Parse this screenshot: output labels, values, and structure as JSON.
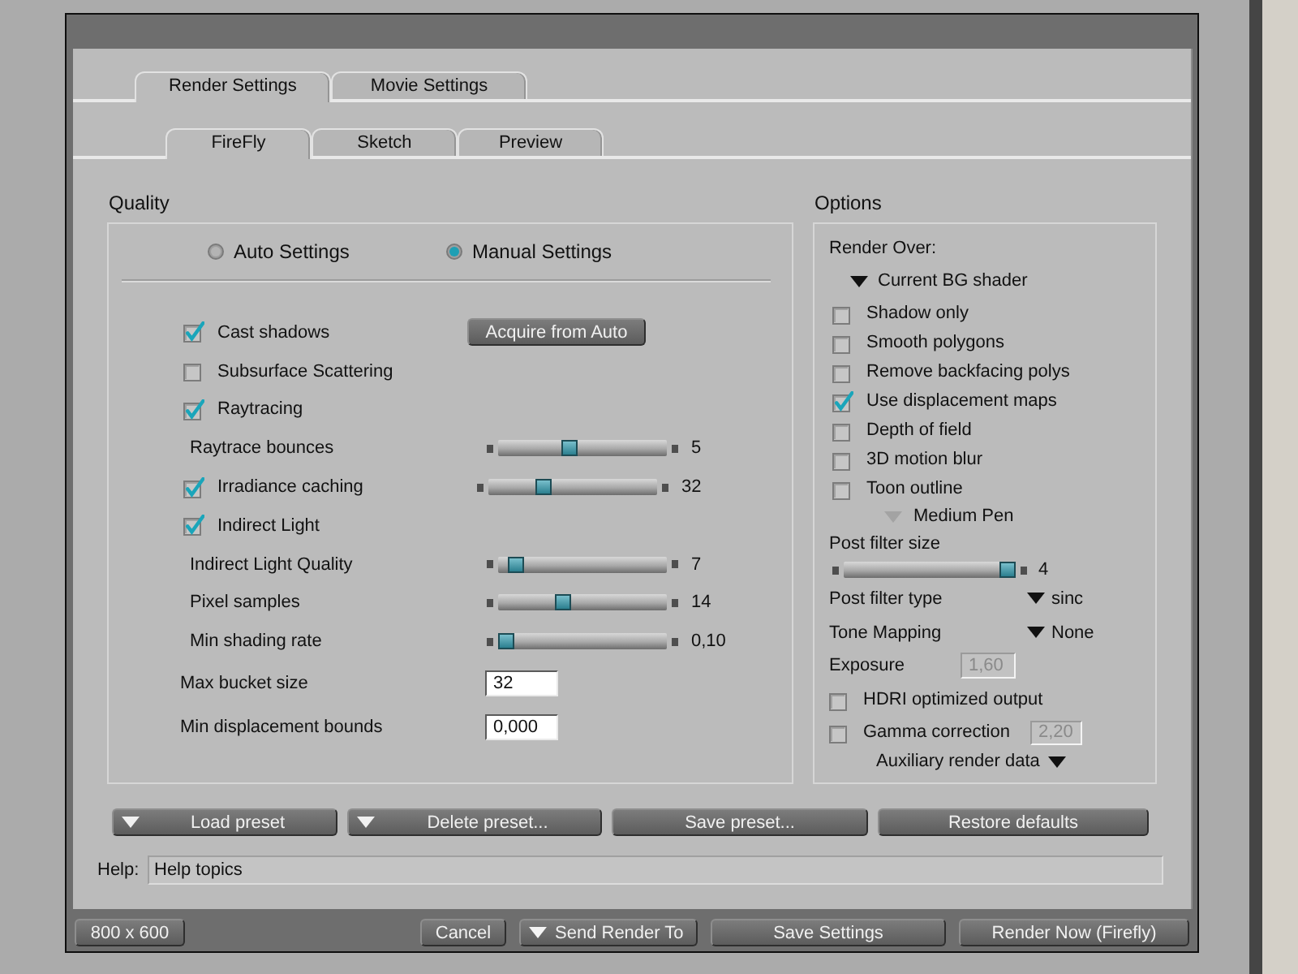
{
  "tabs": [
    {
      "label": "Render Settings",
      "selected": true
    },
    {
      "label": "Movie Settings",
      "selected": false
    }
  ],
  "subtabs": [
    {
      "label": "FireFly",
      "selected": true
    },
    {
      "label": "Sketch",
      "selected": false
    },
    {
      "label": "Preview",
      "selected": false
    }
  ],
  "quality": {
    "title": "Quality",
    "modes": [
      {
        "label": "Auto Settings",
        "selected": false
      },
      {
        "label": "Manual Settings",
        "selected": true
      }
    ],
    "acquire_button": "Acquire from Auto",
    "rows": [
      {
        "kind": "checkbox",
        "label": "Cast shadows",
        "checked": true
      },
      {
        "kind": "checkbox",
        "label": "Subsurface Scattering",
        "checked": false
      },
      {
        "kind": "checkbox",
        "label": "Raytracing",
        "checked": true
      },
      {
        "kind": "slider",
        "label": "Raytrace bounces",
        "level": 0.42,
        "reading": "5"
      },
      {
        "kind": "checkbox_slider",
        "label": "Irradiance caching",
        "checked": true,
        "level": 0.31,
        "reading": "32"
      },
      {
        "kind": "checkbox",
        "label": "Indirect Light",
        "checked": true
      },
      {
        "kind": "slider",
        "label": "Indirect Light Quality",
        "level": 0.06,
        "reading": "7"
      },
      {
        "kind": "slider",
        "label": "Pixel samples",
        "level": 0.37,
        "reading": "14"
      },
      {
        "kind": "slider",
        "label": "Min shading rate",
        "level": 0.0,
        "reading": "0,10"
      },
      {
        "kind": "input",
        "label": "Max bucket size",
        "value": "32"
      },
      {
        "kind": "input",
        "label": "Min displacement bounds",
        "value": "0,000"
      }
    ]
  },
  "options": {
    "title": "Options",
    "render_over": {
      "label": "Render Over:",
      "value": "Current BG shader"
    },
    "checkboxes": [
      {
        "label": "Shadow only",
        "checked": false
      },
      {
        "label": "Smooth polygons",
        "checked": false
      },
      {
        "label": "Remove backfacing polys",
        "checked": false
      },
      {
        "label": "Use displacement maps",
        "checked": true
      },
      {
        "label": "Depth of field",
        "checked": false
      },
      {
        "label": "3D motion blur",
        "checked": false
      },
      {
        "label": "Toon outline",
        "checked": false
      }
    ],
    "toon_pen": {
      "value": "Medium Pen",
      "disabled": true
    },
    "rows": [
      {
        "kind": "slider",
        "label": "Post filter size",
        "level": 1.0,
        "reading": "4"
      },
      {
        "kind": "dropdown",
        "label": "Post filter type",
        "value": "sinc"
      },
      {
        "kind": "dropdown",
        "label": "Tone Mapping",
        "value": "None"
      },
      {
        "kind": "input",
        "label": "Exposure",
        "value": "1,60",
        "disabled": true
      },
      {
        "kind": "checkbox",
        "label": "HDRI optimized output",
        "checked": false
      },
      {
        "kind": "checkbox_input",
        "label": "Gamma correction",
        "checked": false,
        "value": "2,20",
        "disabled": true
      },
      {
        "kind": "menu",
        "label": "Auxiliary render data"
      }
    ]
  },
  "preset_buttons": [
    {
      "label": "Load preset",
      "kind": "menu"
    },
    {
      "label": "Delete preset...",
      "kind": "menu"
    },
    {
      "label": "Save preset...",
      "kind": "plain"
    },
    {
      "label": "Restore defaults",
      "kind": "plain"
    }
  ],
  "help": {
    "label": "Help:",
    "value": "Help topics"
  },
  "footer": {
    "size_button": "800 x 600",
    "buttons": [
      {
        "label": "Cancel",
        "kind": "plain"
      },
      {
        "label": "Send Render To",
        "kind": "menu"
      },
      {
        "label": "Save Settings",
        "kind": "plain"
      },
      {
        "label": "Render Now (Firefly)",
        "kind": "plain"
      }
    ]
  }
}
